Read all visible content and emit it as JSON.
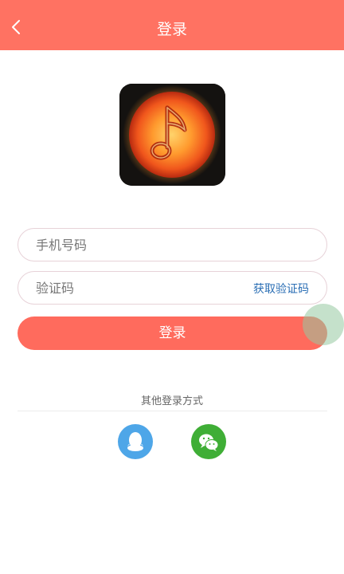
{
  "header": {
    "title": "登录",
    "back_icon": "chevron-left-icon"
  },
  "logo": {
    "icon": "sun-music-note-logo"
  },
  "form": {
    "phone_placeholder": "手机号码",
    "code_placeholder": "验证码",
    "get_code_label": "获取验证码",
    "login_label": "登录"
  },
  "other_login": {
    "label": "其他登录方式",
    "providers": [
      {
        "name": "qq",
        "icon": "qq-icon",
        "color": "#4EA6E8"
      },
      {
        "name": "wechat",
        "icon": "wechat-icon",
        "color": "#3FAE36"
      }
    ]
  },
  "colors": {
    "accent": "#FF7262",
    "link": "#2A6EB4"
  }
}
